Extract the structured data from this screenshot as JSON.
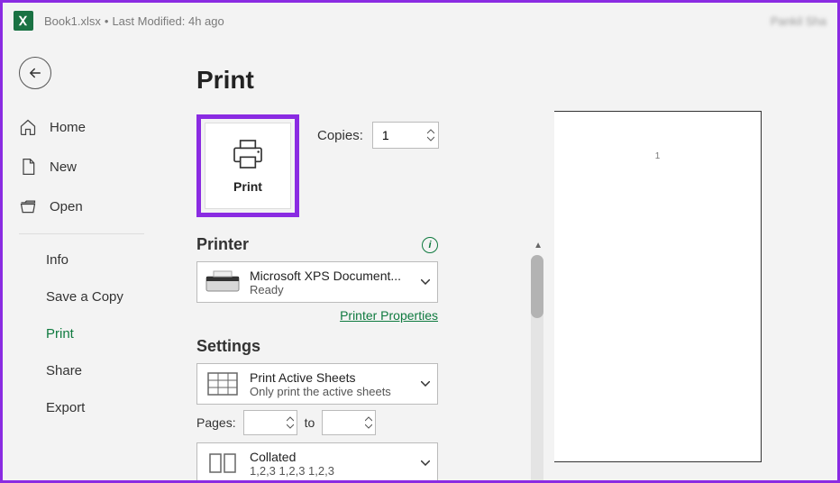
{
  "titlebar": {
    "filename": "Book1.xlsx",
    "modified": "Last Modified: 4h ago",
    "username": "Pankil Sha"
  },
  "sidebar": {
    "home": "Home",
    "new": "New",
    "open": "Open",
    "info": "Info",
    "saveacopy": "Save a Copy",
    "print": "Print",
    "share": "Share",
    "export": "Export"
  },
  "main": {
    "title": "Print",
    "printbtn": "Print",
    "copies_label": "Copies:",
    "copies_value": "1",
    "printer_section": "Printer",
    "printer_name": "Microsoft XPS Document...",
    "printer_status": "Ready",
    "printer_props": "Printer Properties",
    "settings_section": "Settings",
    "sheets_line1": "Print Active Sheets",
    "sheets_line2": "Only print the active sheets",
    "pages_label": "Pages:",
    "to_label": "to",
    "collated_line1": "Collated",
    "collated_line2": "1,2,3    1,2,3    1,2,3",
    "preview_content": "1"
  }
}
